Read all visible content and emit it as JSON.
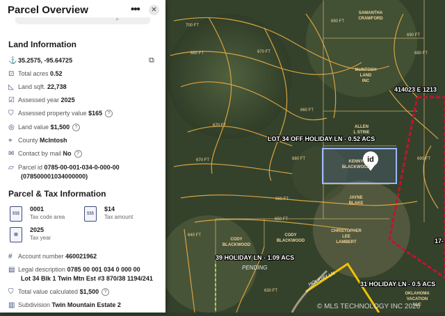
{
  "panel": {
    "title": "Parcel Overview",
    "more_icon": "more-horizontal-icon",
    "close_icon": "close-icon",
    "land_info": {
      "heading": "Land Information",
      "coords": "35.2575, -95.64725",
      "total_acres_label": "Total acres",
      "total_acres": "0.52",
      "sqft_label": "Land sqft.",
      "sqft": "22,738",
      "assessed_year_label": "Assessed year",
      "assessed_year": "2025",
      "assessed_value_label": "Assessed property value",
      "assessed_value": "$165",
      "land_value_label": "Land value",
      "land_value": "$1,500",
      "county_label": "County",
      "county": "McIntosh",
      "contact_label": "Contact by mail",
      "contact": "No",
      "parcel_id_label": "Parcel id",
      "parcel_id": "0785-00-001-034-0-000-00",
      "parcel_id_alt": "(078500001034000000)"
    },
    "tax_info": {
      "heading": "Parcel & Tax Information",
      "tiles": [
        {
          "value": "0001",
          "label": "Tax code area"
        },
        {
          "value": "$14",
          "label": "Tax amount"
        },
        {
          "value": "2025",
          "label": "Tax year"
        }
      ],
      "account_label": "Account number",
      "account": "460021962",
      "legal_label": "Legal description",
      "legal_line1": "0785 00 001 034 0 000 00",
      "legal_line2": "Lot 34 Blk 1 Twin Mtn Est #3 870/38 1194/241",
      "total_value_label": "Total value calculated",
      "total_value": "$1,500",
      "subdivision_label": "Subdivision",
      "subdivision": "Twin Mountain Estate 2"
    }
  },
  "map": {
    "contours": [
      "700 FT",
      "690 FT",
      "690 FT",
      "680 FT",
      "670 FT",
      "680 FT",
      "660 FT",
      "670 FT",
      "670 FT",
      "660 FT",
      "650 FT",
      "640 FT",
      "630 FT",
      "690 FT",
      "680 FT"
    ],
    "owners": [
      "SAMANTHA",
      "CRAWFORD",
      "McINTOSH",
      "LAND",
      "INC",
      "ALLEN",
      "L STINE",
      "KENNY",
      "BLACKWOOD",
      "JAYNE",
      "BLAKE",
      "CODY",
      "BLACKWOOD",
      "CODY",
      "BLACKWOOD",
      "CHRISTOPHER",
      "LEE",
      "LAMBERT",
      "OKLAHOMA",
      "VACATION",
      "LLC"
    ],
    "listings": {
      "lot34": "LOT 34 OFF HOLIDAY LN - 0.52 ACS",
      "addr": "414023 E 1213",
      "h39": "39 HOLIDAY LN - 1.09 ACS",
      "h31": "31 HOLIDAY LN - 0.5 ACS",
      "edge": "17-"
    },
    "pending": "PENDING",
    "road": "HOLIDAY LN",
    "pin_label": "id",
    "watermark": "© MLS TECHNOLOGY INC 2026"
  },
  "colors": {
    "contour": "#d9a441",
    "red_boundary": "#c8102e",
    "yellow_boundary": "#f2c200",
    "green_boundary": "#9fd36b",
    "selection": "#9db8ff",
    "panel_accent": "#3a4b73"
  }
}
